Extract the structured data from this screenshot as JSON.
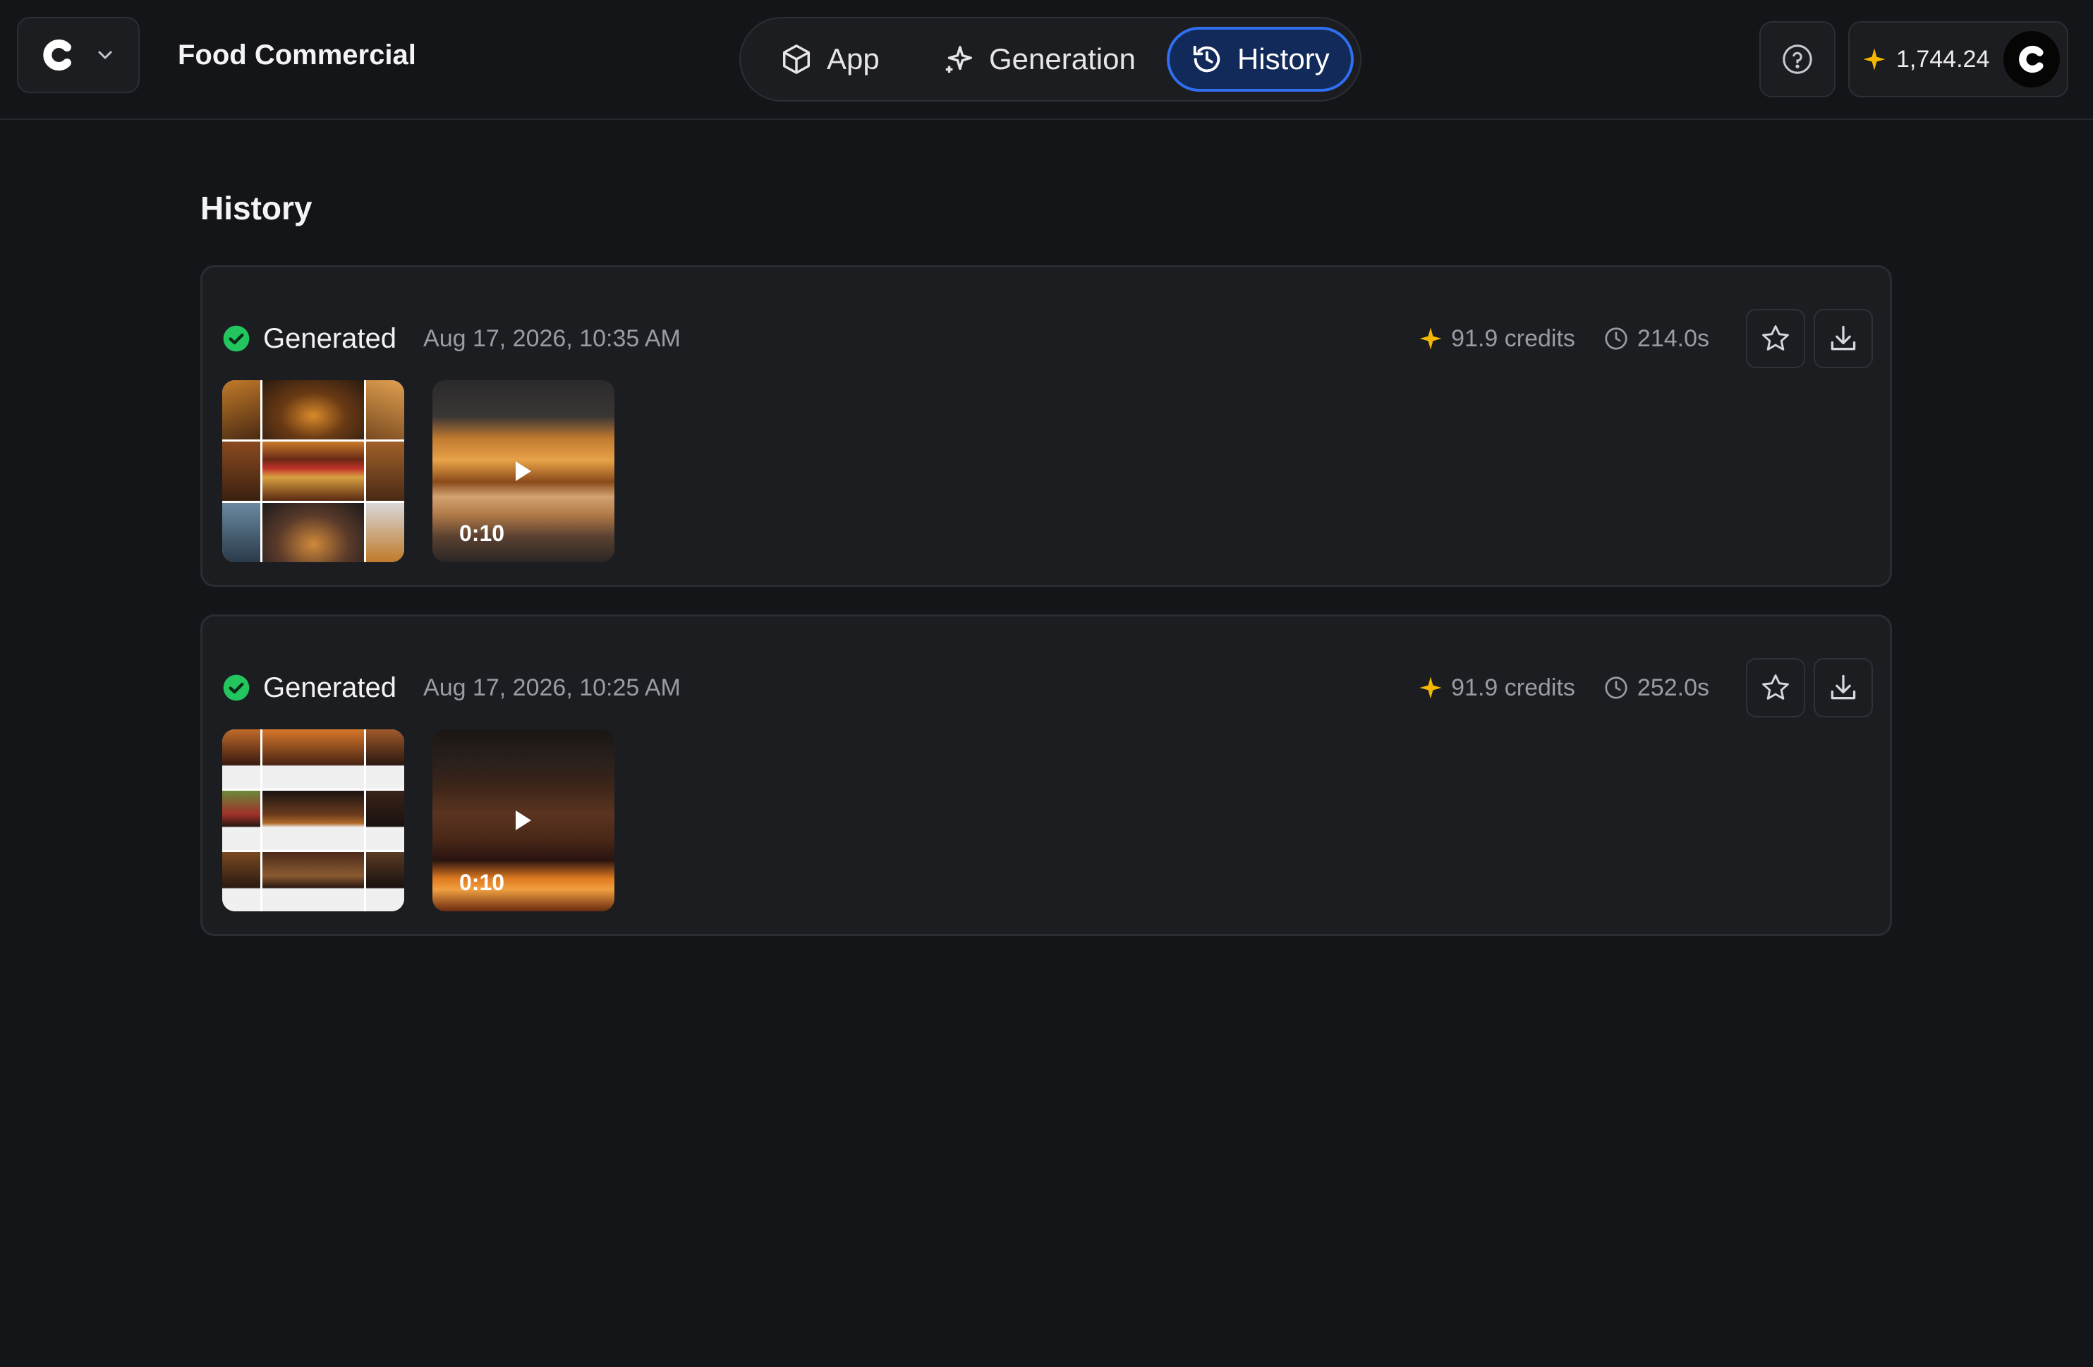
{
  "header": {
    "app_name": "Food Commercial",
    "credits": "1,744.24"
  },
  "nav": {
    "tabs": [
      {
        "label": "App",
        "icon": "cube-icon"
      },
      {
        "label": "Generation",
        "icon": "sparkles-icon"
      },
      {
        "label": "History",
        "icon": "history-clock-icon",
        "active": true
      }
    ]
  },
  "page": {
    "title": "History"
  },
  "history": [
    {
      "status": "Generated",
      "date": "Aug 17, 2026, 10:35 AM",
      "credits": "91.9 credits",
      "duration": "214.0s",
      "video_length": "0:10"
    },
    {
      "status": "Generated",
      "date": "Aug 17, 2026, 10:25 AM",
      "credits": "91.9 credits",
      "duration": "252.0s",
      "video_length": "0:10"
    }
  ],
  "colors": {
    "accent": "#2f6ff0",
    "success": "#22c55e",
    "credit_star": "#f5b800",
    "background": "#141518",
    "surface": "#1c1d21"
  }
}
